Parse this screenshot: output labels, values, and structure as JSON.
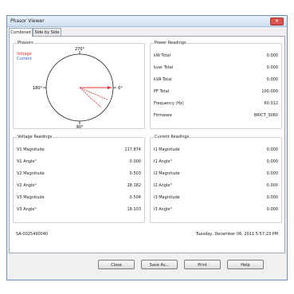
{
  "window": {
    "title": "Phasor Viewer",
    "close_glyph": "✕"
  },
  "tabs": [
    {
      "label": "Combined"
    },
    {
      "label": "Side by Side"
    }
  ],
  "phasors": {
    "title": "Phasors",
    "legend": [
      {
        "label": "Voltage",
        "color": "#e03131"
      },
      {
        "label": "Current",
        "color": "#2f5fe0"
      }
    ],
    "angle_labels": {
      "top": "270°",
      "left": "180°",
      "right": "0°",
      "bottom": "90°"
    }
  },
  "power_readings": {
    "title": "Power Readings",
    "rows": [
      {
        "label": "kW Total",
        "value": "0.000"
      },
      {
        "label": "kvar Total",
        "value": "0.000"
      },
      {
        "label": "kVA Total",
        "value": "0.000"
      },
      {
        "label": "PF Total",
        "value": "100.000"
      },
      {
        "label": "Frequency (Hz)",
        "value": "60.012"
      },
      {
        "label": "Firmware",
        "value": "BRICT_3060"
      }
    ]
  },
  "voltage_readings": {
    "title": "Voltage Readings",
    "rows": [
      {
        "label": "V1 Magnitude",
        "value": "117.874"
      },
      {
        "label": "V1 Angle°",
        "value": "0.000"
      },
      {
        "label": "V2 Magnitude",
        "value": "0.503"
      },
      {
        "label": "V2 Angle°",
        "value": "28.182"
      },
      {
        "label": "V3 Magnitude",
        "value": "0.504"
      },
      {
        "label": "V3 Angle°",
        "value": "18.103"
      }
    ]
  },
  "current_readings": {
    "title": "Current Readings",
    "rows": [
      {
        "label": "I1 Magnitude",
        "value": "0.000"
      },
      {
        "label": "I1 Angle°",
        "value": "0.000"
      },
      {
        "label": "I2 Magnitude",
        "value": "0.000"
      },
      {
        "label": "I2 Angle°",
        "value": "0.000"
      },
      {
        "label": "I3 Magnitude",
        "value": "0.000"
      },
      {
        "label": "I3 Angle°",
        "value": "0.000"
      }
    ]
  },
  "status": {
    "serial": "SA-0025490040",
    "datetime": "Tuesday, December 06, 2011 5:57:23 PM"
  },
  "buttons": {
    "close": "Close",
    "save_as": "Save As...",
    "print": "Print",
    "help": "Help"
  }
}
